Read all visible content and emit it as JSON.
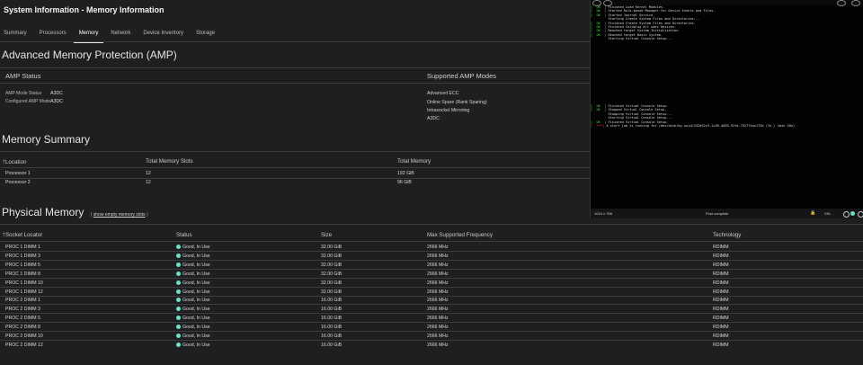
{
  "title": "System Information - Memory Information",
  "tabs": [
    "Summary",
    "Processors",
    "Memory",
    "Network",
    "Device Inventory",
    "Storage"
  ],
  "active_tab": "Memory",
  "amp": {
    "heading": "Advanced Memory Protection (AMP)",
    "status_heading": "AMP Status",
    "mode_status_label": "AMP Mode Status",
    "mode_status_value": "A3DC",
    "configured_label": "Configured AMP Mode",
    "configured_value": "A3DC",
    "supported_heading": "Supported AMP Modes",
    "supported_modes": [
      "Advanced ECC",
      "Online Spare (Rank Sparing)",
      "Intrasocket Mirroring",
      "A3DC"
    ]
  },
  "memory_summary": {
    "heading": "Memory Summary",
    "columns": [
      "Location",
      "Total Memory Slots",
      "Total Memory"
    ],
    "rows": [
      {
        "location": "Processor 1",
        "slots": "12",
        "total": "192 GiB"
      },
      {
        "location": "Processor 2",
        "slots": "12",
        "total": "96 GiB"
      }
    ]
  },
  "physical_memory": {
    "heading": "Physical Memory",
    "show_empty_link": "show empty memory slots",
    "columns": [
      "Socket Locator",
      "Status",
      "Size",
      "Max Supported Frequency",
      "Technology"
    ],
    "rows": [
      {
        "socket": "PROC 1 DIMM 1",
        "status": "Good, In Use",
        "size": "32.00 GiB",
        "freq": "2666 MHz",
        "tech": "RDIMM"
      },
      {
        "socket": "PROC 1 DIMM 3",
        "status": "Good, In Use",
        "size": "32.00 GiB",
        "freq": "2666 MHz",
        "tech": "RDIMM"
      },
      {
        "socket": "PROC 1 DIMM 5",
        "status": "Good, In Use",
        "size": "32.00 GiB",
        "freq": "2666 MHz",
        "tech": "RDIMM"
      },
      {
        "socket": "PROC 1 DIMM 8",
        "status": "Good, In Use",
        "size": "32.00 GiB",
        "freq": "2666 MHz",
        "tech": "RDIMM"
      },
      {
        "socket": "PROC 1 DIMM 10",
        "status": "Good, In Use",
        "size": "32.00 GiB",
        "freq": "2666 MHz",
        "tech": "RDIMM"
      },
      {
        "socket": "PROC 1 DIMM 12",
        "status": "Good, In Use",
        "size": "32.00 GiB",
        "freq": "2666 MHz",
        "tech": "RDIMM"
      },
      {
        "socket": "PROC 2 DIMM 1",
        "status": "Good, In Use",
        "size": "16.00 GiB",
        "freq": "2666 MHz",
        "tech": "RDIMM"
      },
      {
        "socket": "PROC 2 DIMM 3",
        "status": "Good, In Use",
        "size": "16.00 GiB",
        "freq": "2666 MHz",
        "tech": "RDIMM"
      },
      {
        "socket": "PROC 2 DIMM 5",
        "status": "Good, In Use",
        "size": "16.00 GiB",
        "freq": "2666 MHz",
        "tech": "RDIMM"
      },
      {
        "socket": "PROC 2 DIMM 8",
        "status": "Good, In Use",
        "size": "16.00 GiB",
        "freq": "2666 MHz",
        "tech": "RDIMM"
      },
      {
        "socket": "PROC 2 DIMM 10",
        "status": "Good, In Use",
        "size": "16.00 GiB",
        "freq": "2666 MHz",
        "tech": "RDIMM"
      },
      {
        "socket": "PROC 2 DIMM 12",
        "status": "Good, In Use",
        "size": "16.00 GiB",
        "freq": "2666 MHz",
        "tech": "RDIMM"
      }
    ]
  },
  "console": {
    "lines_top": [
      {
        "ok": "[  OK  ]",
        "text": " Finished Load Kernel Modules."
      },
      {
        "ok": "[  OK  ]",
        "text": " Started Rule-based Manager for Device Events and Files."
      },
      {
        "ok": "[  OK  ]",
        "text": " Started Journal Service."
      },
      {
        "ok": "",
        "text": "         Starting Create System Files and Directories..."
      },
      {
        "ok": "[  OK  ]",
        "text": " Finished Create System Files and Directories."
      },
      {
        "ok": "[  OK  ]",
        "text": " Finished Coldplug All udev Devices."
      },
      {
        "ok": "[  OK  ]",
        "text": " Reached target System Initialization."
      },
      {
        "ok": "[  OK  ]",
        "text": " Reached target Basic System."
      },
      {
        "ok": "",
        "text": "         Starting Virtual Console Setup..."
      }
    ],
    "lines_bottom": [
      {
        "ok": "[  OK  ]",
        "text": " Finished Virtual Console Setup."
      },
      {
        "ok": "[  OK  ]",
        "text": " Stopped Virtual Console Setup."
      },
      {
        "ok": "",
        "text": "         Stopping Virtual Console Setup..."
      },
      {
        "ok": "",
        "text": "         Starting Virtual Console Setup..."
      },
      {
        "ok": "[  OK  ]",
        "text": " Finished Virtual Console Setup."
      },
      {
        "ok": "[  ***]",
        "text": " A start job is running for /dev/disk/by-uuid/432d52c5-1c39-4036-92fa-7927f3ac172b (3s / 1min 30s)"
      }
    ],
    "resolution": "1024 x 768",
    "status": "Post complete",
    "ssl": "SSL"
  }
}
